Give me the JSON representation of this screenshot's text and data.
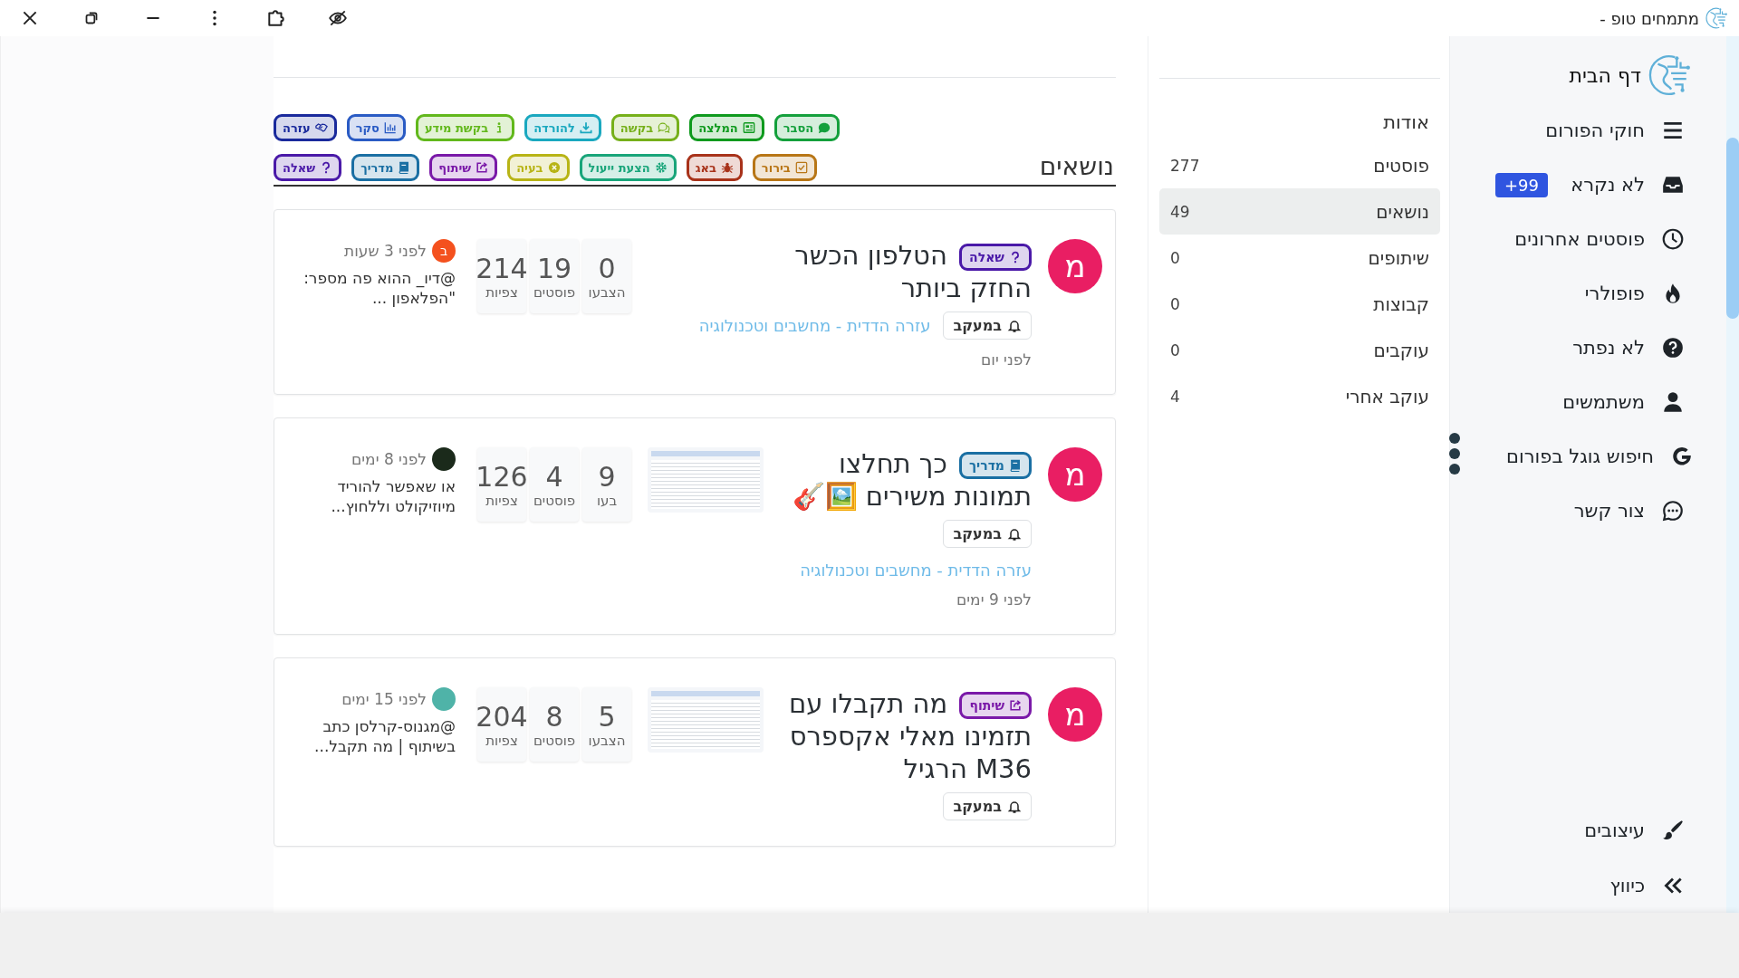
{
  "title_bar": {
    "title": "מתמחים טופ -"
  },
  "sidebar": {
    "home": "דף הבית",
    "items": [
      {
        "label": "חוקי הפורום"
      },
      {
        "label": "לא נקרא",
        "badge": "+99"
      },
      {
        "label": "פוסטים אחרונים"
      },
      {
        "label": "פופולרי"
      },
      {
        "label": "לא נפתר"
      },
      {
        "label": "משתמשים"
      },
      {
        "label": "חיפוש גוגל בפורום"
      },
      {
        "label": "צור קשר"
      }
    ],
    "bottom_items": [
      {
        "label": "עיצובים"
      },
      {
        "label": "כיווץ"
      }
    ]
  },
  "stats": {
    "heading": "אודות",
    "items": [
      {
        "label": "פוסטים",
        "count": "277",
        "selected": false
      },
      {
        "label": "נושאים",
        "count": "49",
        "selected": true
      },
      {
        "label": "שיתופים",
        "count": "0",
        "selected": false
      },
      {
        "label": "קבוצות",
        "count": "0",
        "selected": false
      },
      {
        "label": "עוקבים",
        "count": "0",
        "selected": false
      },
      {
        "label": "עוקב אחרי",
        "count": "4",
        "selected": false
      }
    ]
  },
  "heading": "נושאים",
  "tags": {
    "row_1": [
      {
        "label": "הסבר",
        "kind": "explain",
        "color": "#14a03c"
      },
      {
        "label": "המלצה",
        "kind": "recommend",
        "color": "#0f9a1e"
      },
      {
        "label": "בקשה",
        "kind": "request",
        "color": "#76b01a"
      },
      {
        "label": "להורדה",
        "kind": "download",
        "color": "#1aa8bf"
      },
      {
        "label": "בקשת מידע",
        "kind": "info",
        "color": "#62b81c"
      },
      {
        "label": "סקר",
        "kind": "poll",
        "color": "#2a5bc4"
      },
      {
        "label": "עזרה",
        "kind": "help",
        "color": "#1a2a9c"
      }
    ],
    "row_2": [
      {
        "label": "בירור",
        "kind": "clarify",
        "color": "#b87616"
      },
      {
        "label": "באג",
        "kind": "bug",
        "color": "#a8321a"
      },
      {
        "label": "הצעת ייעול",
        "kind": "improve",
        "color": "#19a57a"
      },
      {
        "label": "בעיה",
        "kind": "problem",
        "color": "#b8b416"
      },
      {
        "label": "שיתוף",
        "kind": "share",
        "color": "#7a19a8"
      },
      {
        "label": "מדריך",
        "kind": "guide",
        "color": "#1a6fa3"
      },
      {
        "label": "שאלה",
        "kind": "question",
        "color": "#4a19a8"
      }
    ]
  },
  "topics": [
    {
      "avatar": "מ",
      "tag": {
        "label": "שאלה",
        "kind": "question",
        "color": "#4a19a8"
      },
      "title": "הטלפון הכשר החזק ביותר",
      "watch": "במעקב",
      "category": "עזרה הדדית - מחשבים וטכנולוגיה",
      "time": "לפני יום",
      "thumbnail": false,
      "votes": "0",
      "votes_label": "הצבעו",
      "posts": "19",
      "posts_label": "פוסטים",
      "views": "214",
      "views_label": "צפיות",
      "last_post": {
        "avatar": "ב",
        "color": "#f4511e",
        "time": "לפני 3 שעות",
        "text": "@דיו_ ההוא פה מספר: \"הפלאפון ..."
      }
    },
    {
      "avatar": "מ",
      "tag": {
        "label": "מדריך",
        "kind": "guide",
        "color": "#1a6fa3"
      },
      "title": "כך תחלצו תמונות משירים 🖼️🎸",
      "watch": "במעקב",
      "category": "עזרה הדדית - מחשבים וטכנולוגיה",
      "time": "לפני 9 ימים",
      "thumbnail": true,
      "votes": "9",
      "votes_label": "בעו",
      "posts": "4",
      "posts_label": "פוסטים",
      "views": "126",
      "views_label": "צפיות",
      "last_post": {
        "color": "#1b2a1b",
        "time": "לפני 8 ימים",
        "text": "או שאפשר להוריד מיוזיקולט וללחוץ..."
      }
    },
    {
      "avatar": "מ",
      "tag": {
        "label": "שיתוף",
        "kind": "share",
        "color": "#7a19a8"
      },
      "title": "מה תקבלו עם תזמינו מאלי אקספרס M36 הרגיל",
      "watch": "במעקב",
      "thumbnail": true,
      "votes": "5",
      "votes_label": "הצבעו",
      "posts": "8",
      "posts_label": "פוסטים",
      "views": "204",
      "views_label": "צפיות",
      "last_post": {
        "color": "#4fb3a8",
        "time": "לפני 15 ימים",
        "text": "@מגנוס-קרלסן כתב בשיתוף | מה תקבל..."
      }
    }
  ]
}
